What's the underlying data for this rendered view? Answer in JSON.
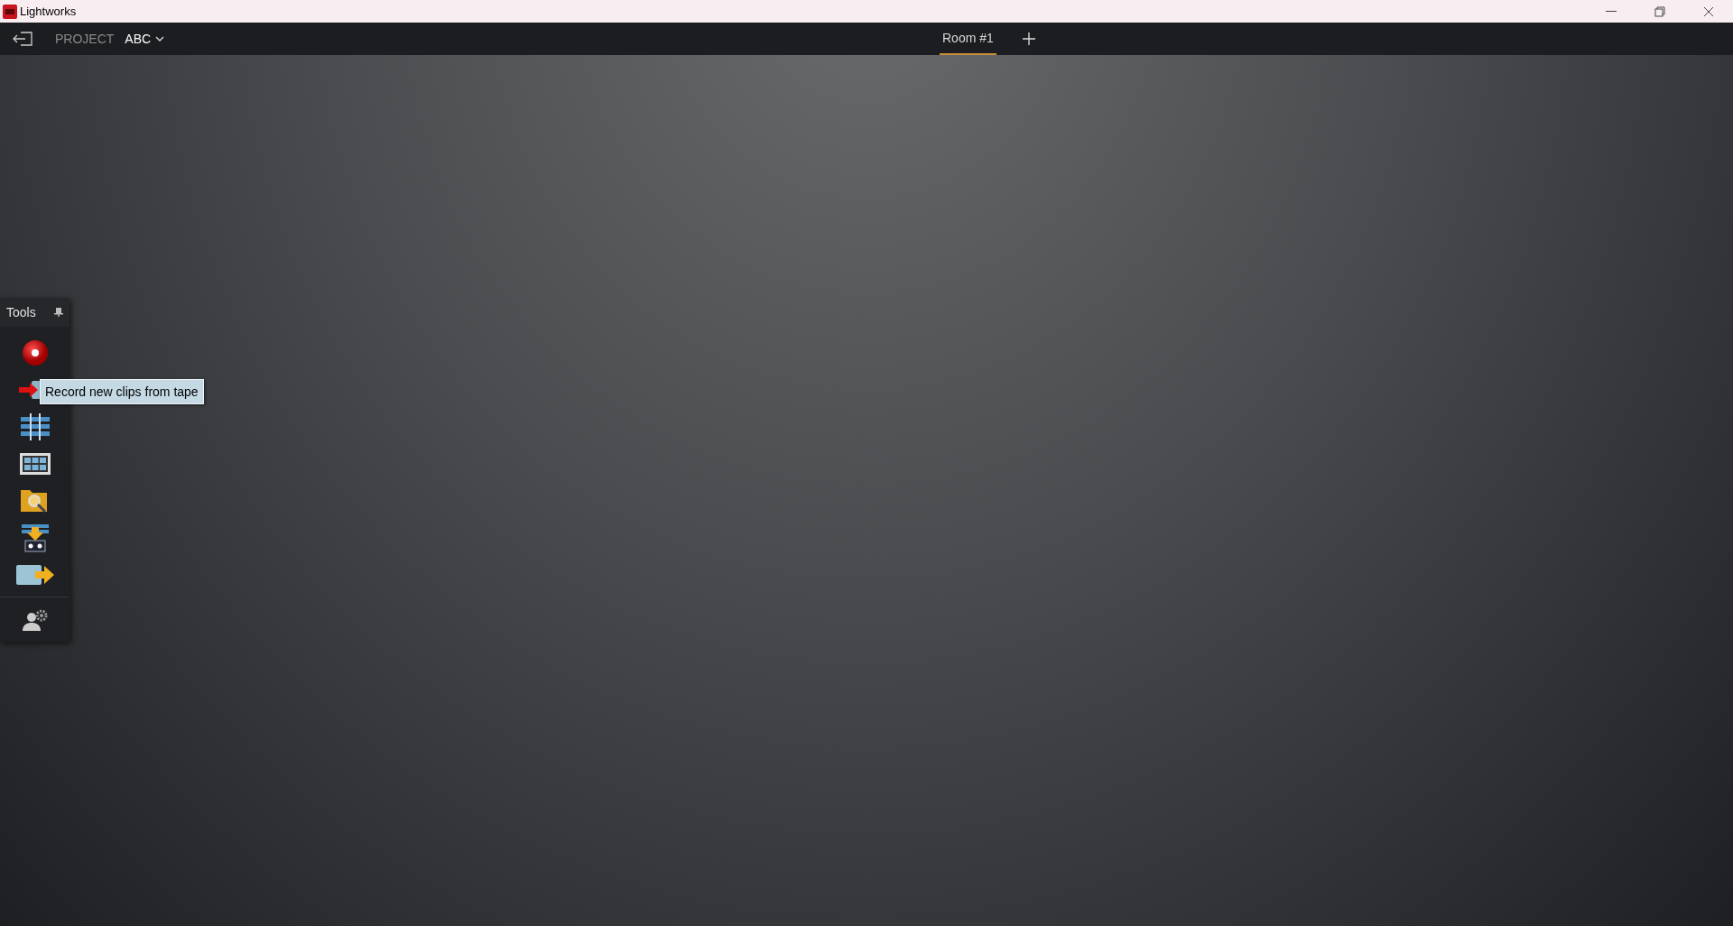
{
  "window": {
    "title": "Lightworks"
  },
  "toolbar": {
    "project_label": "PROJECT",
    "project_name": "ABC"
  },
  "tabs": [
    {
      "label": "Room #1",
      "selected": true
    }
  ],
  "tools_panel": {
    "title": "Tools",
    "tools": [
      {
        "kind": "record"
      },
      {
        "kind": "tape"
      },
      {
        "kind": "bins"
      },
      {
        "kind": "grid"
      },
      {
        "kind": "search"
      },
      {
        "kind": "import"
      },
      {
        "kind": "export"
      },
      {
        "kind": "users"
      }
    ]
  },
  "tooltip": "Record new clips from tape"
}
